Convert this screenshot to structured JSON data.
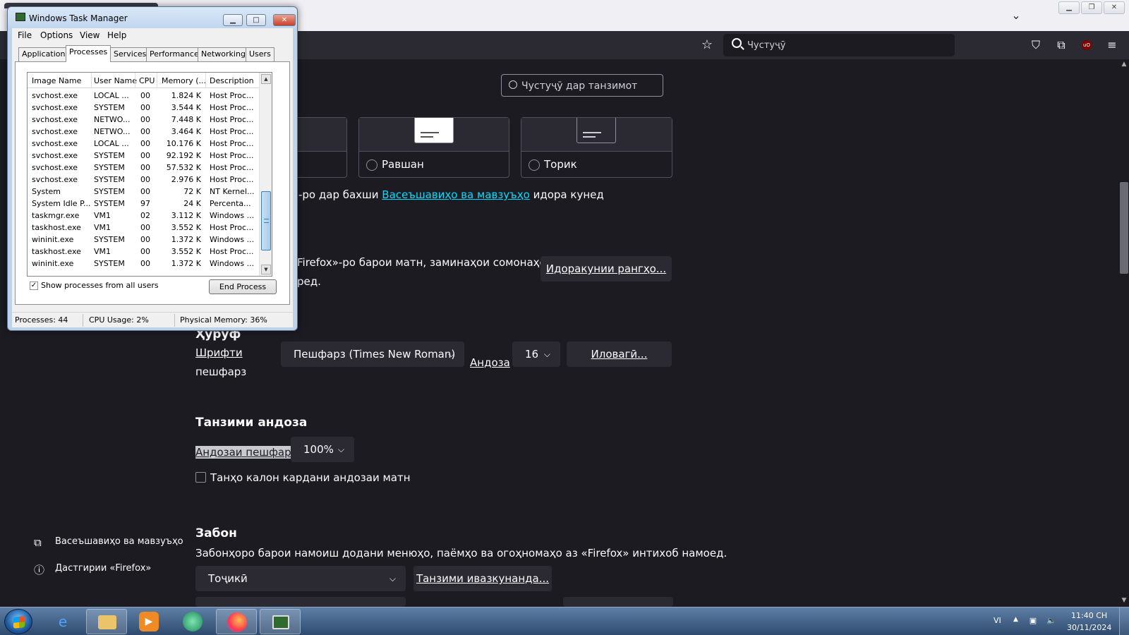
{
  "firefox": {
    "urlbar_placeholder": "Чустуҷӯ",
    "settings_search_placeholder": "Чустуҷӯ дар танзимот",
    "themes": [
      {
        "label": "Равшан"
      },
      {
        "label": "Торик"
      }
    ],
    "theme_note_prefix": "-ро дар бахши ",
    "theme_note_link": "Васеъшавиҳо ва мавзуъҳо",
    "theme_note_suffix": " идора кунед",
    "colors_line1": "Firefox»-ро барои матн, заминаҳои сомонаҳо ва",
    "colors_line2": "ред.",
    "manage_colors_button": "Идоракунии рангҳо...",
    "fonts": {
      "heading": "Ҳуруф",
      "default_font_label_line1": "Шрифти",
      "default_font_label_line2": "пешфарз",
      "default_font_value": "Пешфарз (Times New Roman)",
      "size_label": "Андоза",
      "size_value": "16",
      "advanced_button": "Иловагӣ..."
    },
    "zoom": {
      "heading": "Танзими андоза",
      "default_zoom_label": "Андозаи пешфарз",
      "default_zoom_value": "100%",
      "text_only_label": "Танҳо калон кардани андозаи матн"
    },
    "language": {
      "heading": "Забон",
      "description": "Забонҳоро барои намоиш додани менюҳо, паёмҳо ва огоҳномаҳо аз «Firefox» интихоб намоед.",
      "language_value": "Тоҷикӣ",
      "alternatives_button": "Танзими ивазкунанда..."
    },
    "sidebar": {
      "extensions_label": "Васеъшавиҳо ва мавзуъҳо",
      "support_label": "Дастгирии «Firefox»"
    },
    "colors": {
      "accent_link": "#00ddff",
      "page_bg": "#1c1b22",
      "toolbar_bg": "#2b2a33"
    }
  },
  "taskmanager": {
    "title": "Windows Task Manager",
    "menu": [
      "File",
      "Options",
      "View",
      "Help"
    ],
    "tabs": [
      "Applications",
      "Processes",
      "Services",
      "Performance",
      "Networking",
      "Users"
    ],
    "active_tab": "Processes",
    "columns": [
      "Image Name",
      "User Name",
      "CPU",
      "Memory (...",
      "Description"
    ],
    "rows": [
      [
        "svchost.exe",
        "LOCAL ...",
        "00",
        "1.824 K",
        "Host Proc..."
      ],
      [
        "svchost.exe",
        "SYSTEM",
        "00",
        "3.544 K",
        "Host Proc..."
      ],
      [
        "svchost.exe",
        "NETWO...",
        "00",
        "7.448 K",
        "Host Proc..."
      ],
      [
        "svchost.exe",
        "NETWO...",
        "00",
        "3.464 K",
        "Host Proc..."
      ],
      [
        "svchost.exe",
        "LOCAL ...",
        "00",
        "10.176 K",
        "Host Proc..."
      ],
      [
        "svchost.exe",
        "SYSTEM",
        "00",
        "92.192 K",
        "Host Proc..."
      ],
      [
        "svchost.exe",
        "SYSTEM",
        "00",
        "57.532 K",
        "Host Proc..."
      ],
      [
        "svchost.exe",
        "SYSTEM",
        "00",
        "2.976 K",
        "Host Proc..."
      ],
      [
        "System",
        "SYSTEM",
        "00",
        "72 K",
        "NT Kernel..."
      ],
      [
        "System Idle P...",
        "SYSTEM",
        "97",
        "24 K",
        "Percenta..."
      ],
      [
        "taskmgr.exe",
        "VM1",
        "02",
        "3.112 K",
        "Windows ..."
      ],
      [
        "taskhost.exe",
        "VM1",
        "00",
        "3.552 K",
        "Host Proc..."
      ],
      [
        "wininit.exe",
        "SYSTEM",
        "00",
        "1.372 K",
        "Windows ..."
      ],
      [
        "taskhost.exe",
        "VM1",
        "00",
        "3.552 K",
        "Host Proc..."
      ],
      [
        "wininit.exe",
        "SYSTEM",
        "00",
        "1.372 K",
        "Windows ..."
      ]
    ],
    "show_all_label": "Show processes from all users",
    "show_all_checked": true,
    "end_process_label": "End Process",
    "status": {
      "processes": "Processes: 44",
      "cpu": "CPU Usage: 2%",
      "memory": "Physical Memory: 36%"
    }
  },
  "taskbar": {
    "apps": [
      "internet-explorer",
      "file-explorer",
      "media-player",
      "app-globe",
      "firefox",
      "task-manager"
    ],
    "tray_lang": "VI",
    "clock_time": "11:40 CH",
    "clock_date": "30/11/2024"
  }
}
